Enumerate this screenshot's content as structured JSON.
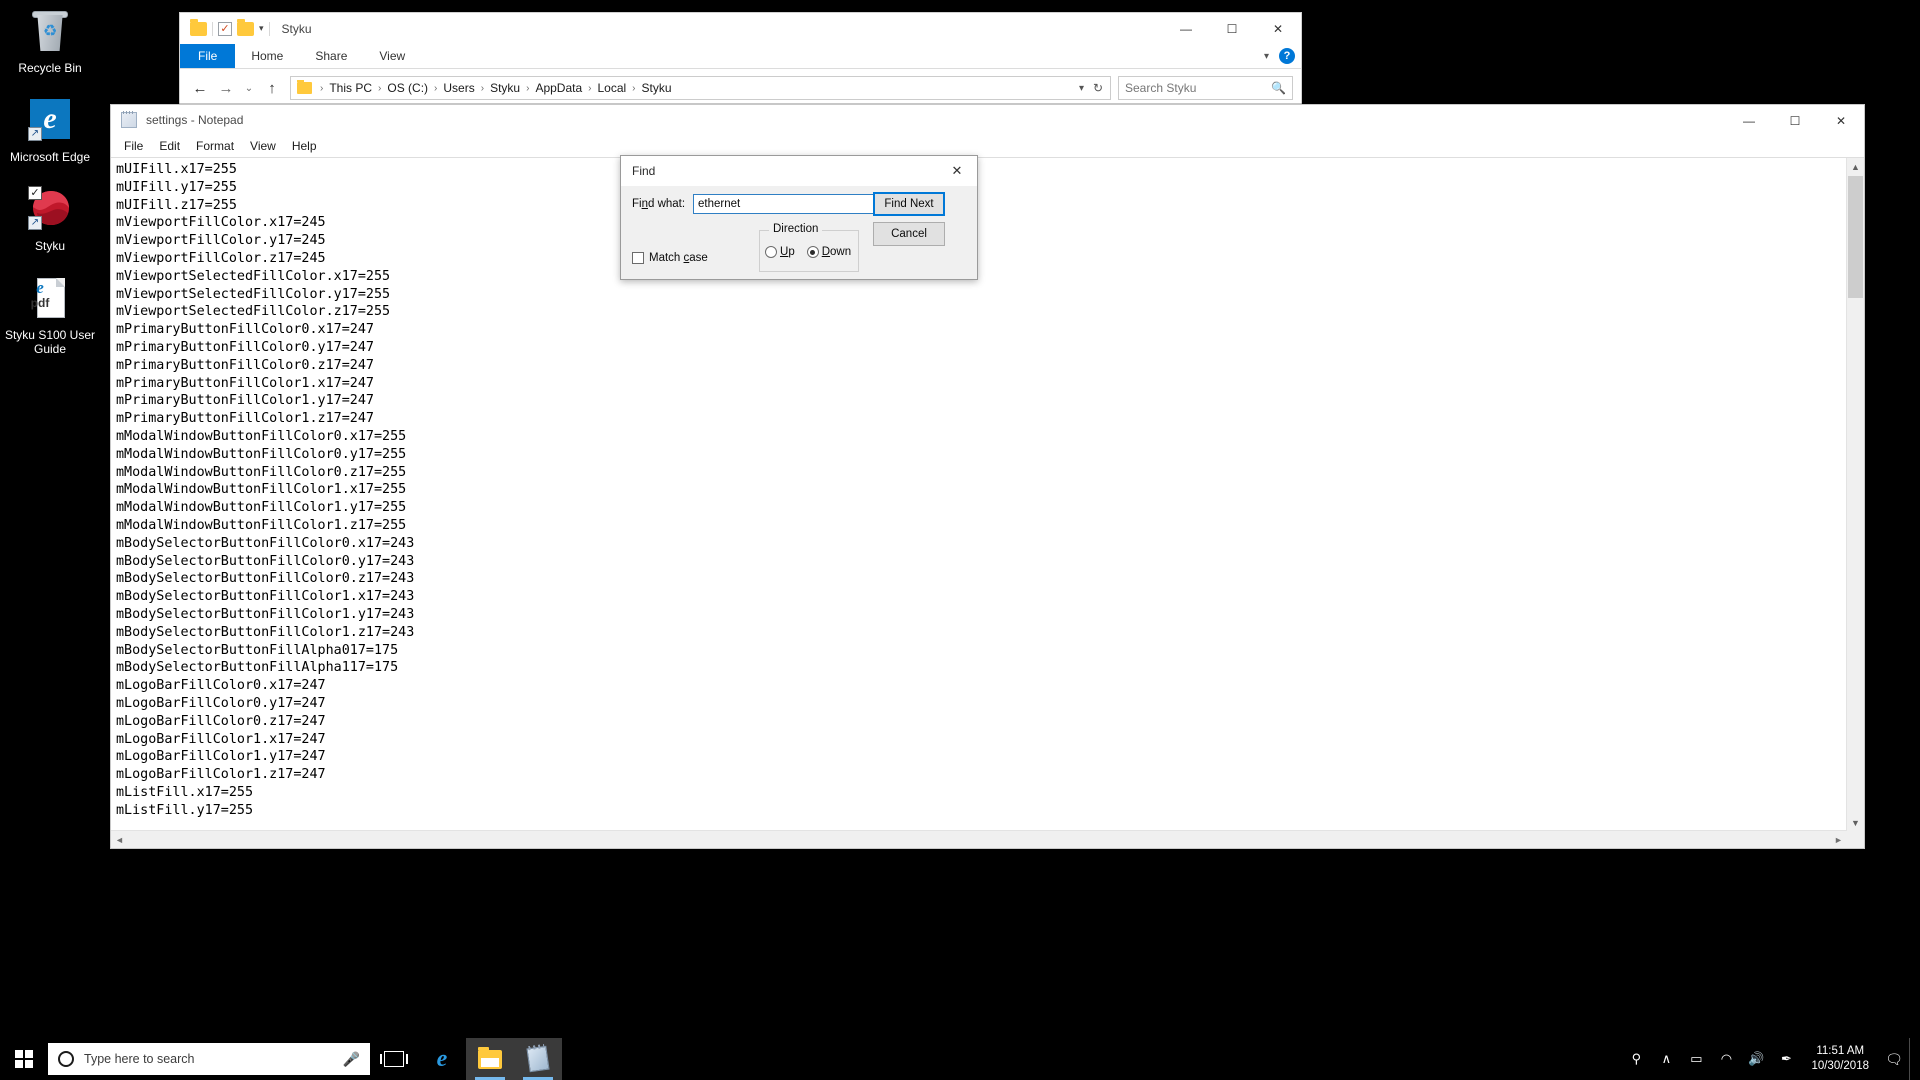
{
  "desktop": {
    "icons": [
      {
        "label": "Recycle Bin",
        "icon": "recycle-bin-icon"
      },
      {
        "label": "Microsoft Edge",
        "icon": "edge-icon"
      },
      {
        "label": "Styku",
        "icon": "styku-icon"
      },
      {
        "label": "Styku S100 User Guide",
        "icon": "pdf-icon"
      }
    ]
  },
  "explorer": {
    "title": "Styku",
    "quick_access": {
      "folder_icon": "folder-icon",
      "properties_icon": "checkbox-icon",
      "new_folder_icon": "folder-icon",
      "customize_caret": "chevron-down-icon"
    },
    "window_controls": {
      "minimize": "—",
      "maximize": "☐",
      "close": "✕"
    },
    "ribbon_tabs": [
      {
        "label": "File",
        "active": true
      },
      {
        "label": "Home",
        "active": false
      },
      {
        "label": "Share",
        "active": false
      },
      {
        "label": "View",
        "active": false
      }
    ],
    "ribbon_right": {
      "collapse_icon": "chevron-down-icon",
      "help_label": "?"
    },
    "nav": {
      "back": "←",
      "forward": "→",
      "recent": "⌄",
      "up": "↑"
    },
    "breadcrumbs": [
      "This PC",
      "OS (C:)",
      "Users",
      "Styku",
      "AppData",
      "Local",
      "Styku"
    ],
    "breadcrumb_separator": "›",
    "address_dropdown_icon": "chevron-down-icon",
    "refresh_icon": "refresh-icon",
    "search": {
      "placeholder": "Search Styku",
      "icon": "search-icon"
    }
  },
  "notepad": {
    "title": "settings - Notepad",
    "icon": "notepad-icon",
    "menus": [
      "File",
      "Edit",
      "Format",
      "View",
      "Help"
    ],
    "window_controls": {
      "minimize": "—",
      "maximize": "☐",
      "close": "✕"
    },
    "content": "mUIFill.x17=255\nmUIFill.y17=255\nmUIFill.z17=255\nmViewportFillColor.x17=245\nmViewportFillColor.y17=245\nmViewportFillColor.z17=245\nmViewportSelectedFillColor.x17=255\nmViewportSelectedFillColor.y17=255\nmViewportSelectedFillColor.z17=255\nmPrimaryButtonFillColor0.x17=247\nmPrimaryButtonFillColor0.y17=247\nmPrimaryButtonFillColor0.z17=247\nmPrimaryButtonFillColor1.x17=247\nmPrimaryButtonFillColor1.y17=247\nmPrimaryButtonFillColor1.z17=247\nmModalWindowButtonFillColor0.x17=255\nmModalWindowButtonFillColor0.y17=255\nmModalWindowButtonFillColor0.z17=255\nmModalWindowButtonFillColor1.x17=255\nmModalWindowButtonFillColor1.y17=255\nmModalWindowButtonFillColor1.z17=255\nmBodySelectorButtonFillColor0.x17=243\nmBodySelectorButtonFillColor0.y17=243\nmBodySelectorButtonFillColor0.z17=243\nmBodySelectorButtonFillColor1.x17=243\nmBodySelectorButtonFillColor1.y17=243\nmBodySelectorButtonFillColor1.z17=243\nmBodySelectorButtonFillAlpha017=175\nmBodySelectorButtonFillAlpha117=175\nmLogoBarFillColor0.x17=247\nmLogoBarFillColor0.y17=247\nmLogoBarFillColor0.z17=247\nmLogoBarFillColor1.x17=247\nmLogoBarFillColor1.y17=247\nmLogoBarFillColor1.z17=247\nmListFill.x17=255\nmListFill.y17=255",
    "scrollbar": {
      "up_arrow": "▲",
      "down_arrow": "▼",
      "left_arrow": "◄",
      "right_arrow": "►"
    }
  },
  "find_dialog": {
    "title": "Find",
    "close_icon": "close-icon",
    "find_what_label_pre": "Fi",
    "find_what_label_accel": "n",
    "find_what_label_post": "d what:",
    "find_what_value": "ethernet",
    "find_next_label": "Find Next",
    "cancel_label": "Cancel",
    "direction_group_label": "Direction",
    "direction_options": [
      {
        "label": "Up",
        "accel": "U",
        "rest": "p",
        "selected": false
      },
      {
        "label": "Down",
        "accel": "D",
        "rest": "own",
        "selected": true
      }
    ],
    "match_case_label_pre": "Match ",
    "match_case_label_accel": "c",
    "match_case_label_post": "ase",
    "match_case_checked": false
  },
  "taskbar": {
    "start_icon": "windows-logo-icon",
    "search_placeholder": "Type here to search",
    "search_icon": "cortana-circle-icon",
    "mic_icon": "microphone-icon",
    "buttons": [
      {
        "name": "task-view",
        "icon": "task-view-icon",
        "active": false
      },
      {
        "name": "edge",
        "icon": "edge-icon",
        "active": false
      },
      {
        "name": "file-explorer",
        "icon": "folder-icon",
        "active": true
      },
      {
        "name": "notepad",
        "icon": "notepad-icon",
        "active": true
      }
    ],
    "tray": [
      {
        "name": "people",
        "glyph": "⚲"
      },
      {
        "name": "show-hidden-icons",
        "glyph": "∧"
      },
      {
        "name": "battery",
        "glyph": "▭"
      },
      {
        "name": "network",
        "glyph": "◠"
      },
      {
        "name": "volume",
        "glyph": "🔊"
      },
      {
        "name": "pen-workspace",
        "glyph": "✒"
      }
    ],
    "clock_time": "11:51 AM",
    "clock_date": "10/30/2018",
    "action_center_icon": "notification-icon"
  }
}
